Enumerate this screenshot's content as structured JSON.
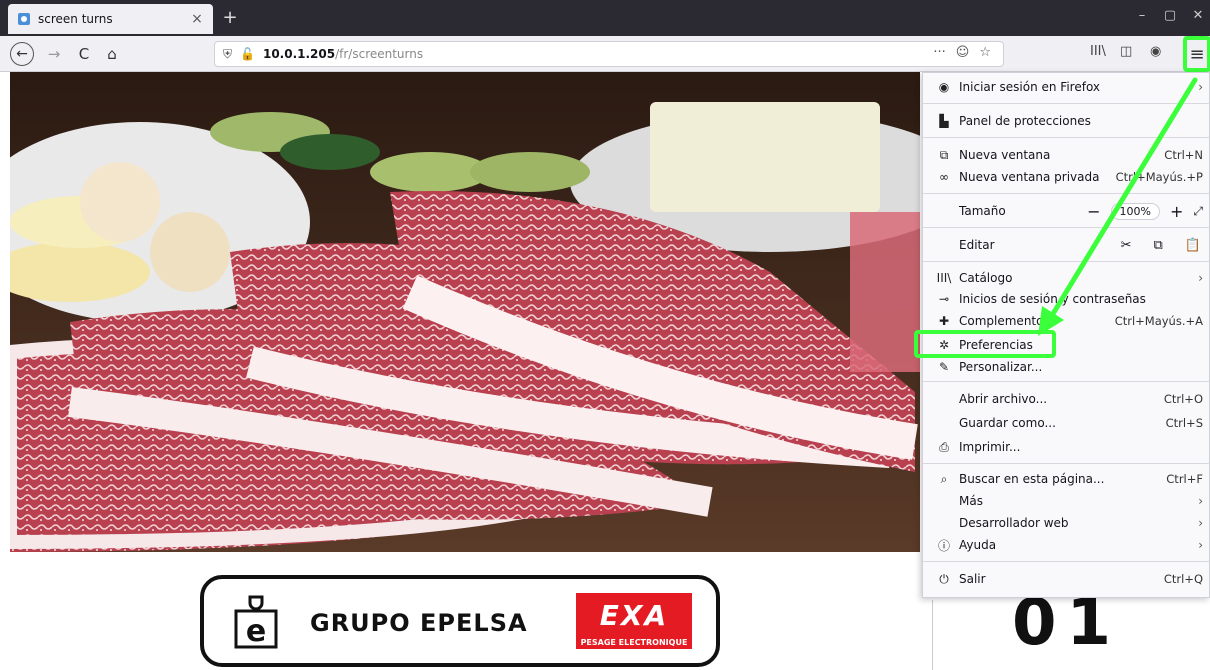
{
  "tab": {
    "title": "screen turns",
    "close": "×"
  },
  "newtab": "+",
  "window": {
    "minimize": "–",
    "maximize": "▢",
    "close": "✕"
  },
  "nav": {
    "back": "←",
    "forward": "→",
    "reload": "C",
    "home": "⌂",
    "url_host": "10.0.1.205",
    "url_path": "/fr/screenturns",
    "url_actions": [
      "···",
      "☺",
      "☆"
    ],
    "library": "III\\",
    "sidebar": "◫",
    "account": "◉",
    "menu": "≡"
  },
  "menu": {
    "signin": "Iniciar sesión en Firefox",
    "protections": "Panel de protecciones",
    "new_window": {
      "label": "Nueva ventana",
      "shortcut": "Ctrl+N"
    },
    "private_window": {
      "label": "Nueva ventana privada",
      "shortcut": "Ctrl+Mayús.+P"
    },
    "zoom": {
      "label": "Tamaño",
      "minus": "−",
      "value": "100%",
      "plus": "+",
      "fullscreen": "⤢"
    },
    "edit": {
      "label": "Editar",
      "cut": "✂",
      "copy": "⧉",
      "paste": "📋"
    },
    "catalog": "Catálogo",
    "logins": "Inicios de sesión y contraseñas",
    "addons": {
      "label": "Complementos",
      "shortcut": "Ctrl+Mayús.+A"
    },
    "preferences": "Preferencias",
    "customize": "Personalizar...",
    "open_file": {
      "label": "Abrir archivo...",
      "shortcut": "Ctrl+O"
    },
    "save_as": {
      "label": "Guardar como...",
      "shortcut": "Ctrl+S"
    },
    "print": "Imprimir...",
    "find": {
      "label": "Buscar en esta página...",
      "shortcut": "Ctrl+F"
    },
    "more": "Más",
    "webdev": "Desarrollador web",
    "help": "Ayuda",
    "quit": {
      "label": "Salir",
      "shortcut": "Ctrl+Q"
    },
    "arrow": "›"
  },
  "logo": {
    "text": "GRUPO EPELSA",
    "exa": "EXA",
    "exa_sub": "PESAGE ELECTRONIQUE",
    "mark": "e"
  },
  "side_number": "01",
  "colors": {
    "highlight": "#3cff3c",
    "tabbar": "#2b2a33",
    "exa_red": "#e41b23"
  }
}
